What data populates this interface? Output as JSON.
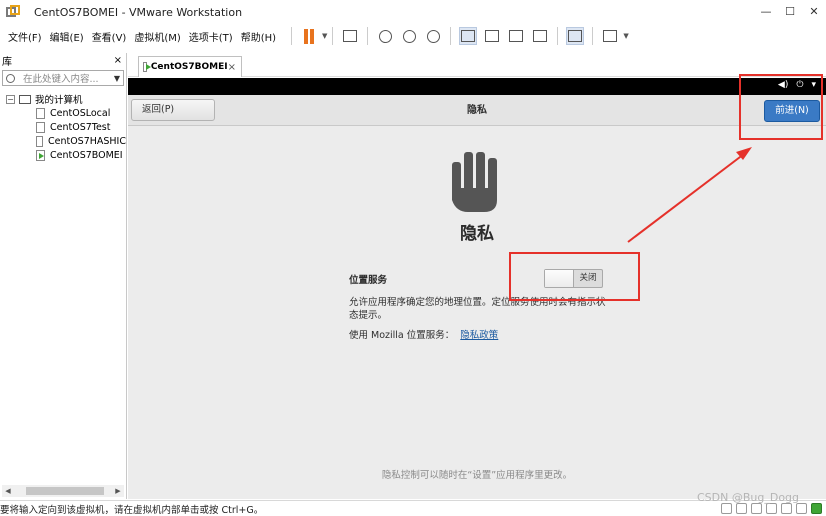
{
  "window": {
    "title": "CentOS7BOMEI - VMware Workstation",
    "buttons": {
      "minimize": "—",
      "maximize": "☐",
      "close": "✕"
    }
  },
  "menu": {
    "items": [
      "文件(F)",
      "编辑(E)",
      "查看(V)",
      "虚拟机(M)",
      "选项卡(T)",
      "帮助(H)"
    ]
  },
  "library": {
    "title": "库",
    "close": "×",
    "search_placeholder": "在此处键入内容...",
    "root": "我的计算机",
    "vms": [
      "CentOSLocal",
      "CentOS7Test",
      "CentOS7HASHIC",
      "CentOS7BOMEI"
    ],
    "running_vm": "CentOS7BOMEI"
  },
  "tabs": [
    {
      "label": "CentOS7BOMEI",
      "close": "×"
    }
  ],
  "gnome": {
    "status_icons": [
      "volume-icon",
      "power-icon",
      "chevron-down-icon"
    ]
  },
  "installer": {
    "back_label": "返回(P)",
    "header_title": "隐私",
    "next_label": "前进(N)",
    "heading": "隐私",
    "location_label": "位置服务",
    "toggle_state": "关闭",
    "location_desc": "允许应用程序确定您的地理位置。定位服务使用时会有指示状态提示。",
    "mozilla_text": "使用 Mozilla 位置服务：",
    "policy_link": "隐私政策",
    "footer_note": "隐私控制可以随时在“设置”应用程序里更改。"
  },
  "status_bar": {
    "text": "要将输入定向到该虚拟机，请在虚拟机内部单击或按 Ctrl+G。",
    "watermark": "CSDN @Bug_Dogg"
  },
  "colors": {
    "annotation": "#e5312a",
    "next_button": "#3a7ac5",
    "pause_icon": "#e8731e"
  }
}
